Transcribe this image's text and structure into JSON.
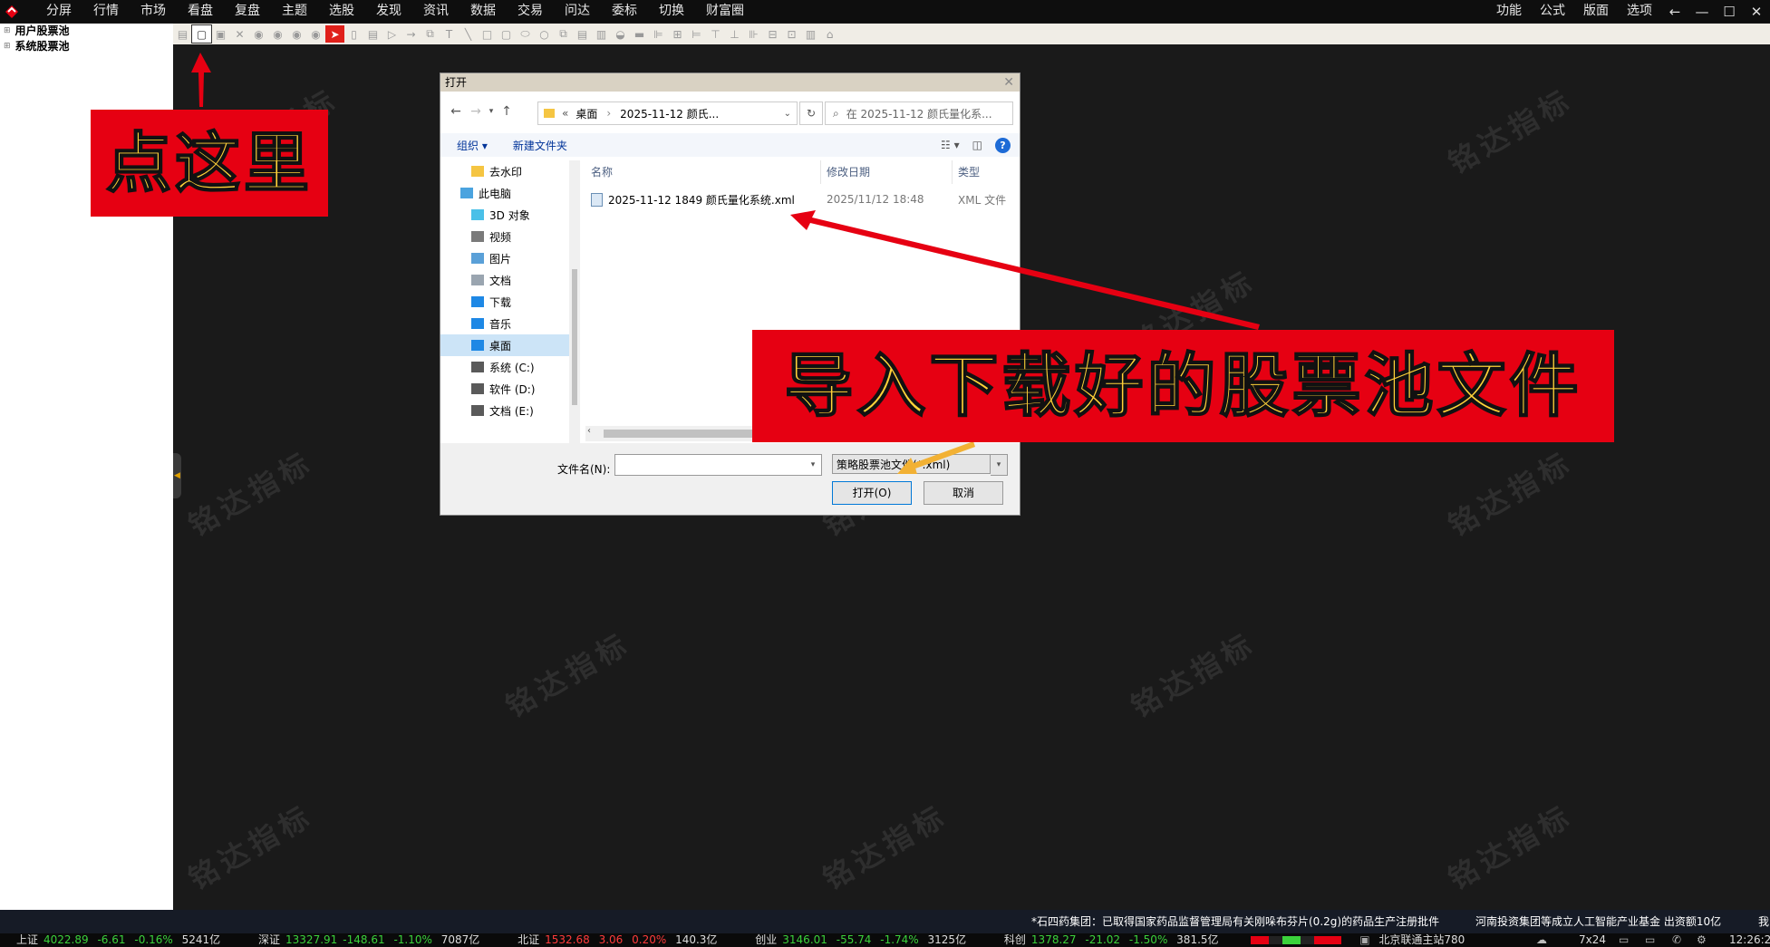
{
  "menu": {
    "left": [
      "分屏",
      "行情",
      "市场",
      "看盘",
      "复盘",
      "主题",
      "选股",
      "发现",
      "资讯",
      "数据",
      "交易",
      "问达",
      "委标",
      "切换",
      "财富圈"
    ],
    "right": [
      "功能",
      "公式",
      "版面",
      "选项"
    ]
  },
  "sidebar": {
    "items": [
      {
        "label": "用户股票池"
      },
      {
        "label": "系统股票池"
      }
    ]
  },
  "watermark": "铭达指标",
  "callouts": {
    "click_here": "点这里",
    "import": "导入下载好的股票池文件"
  },
  "dialog": {
    "title": "打开",
    "address": {
      "prefix": "«",
      "crumb1": "桌面",
      "crumb2": "2025-11-12 颜氏..."
    },
    "search_placeholder": "在 2025-11-12 颜氏量化系...",
    "commands": {
      "organize": "组织 ▾",
      "new_folder": "新建文件夹"
    },
    "nav": [
      {
        "label": "去水印",
        "icon": "folder-icon",
        "color": "#f5c542"
      },
      {
        "label": "此电脑",
        "icon": "computer-icon",
        "color": "#4aa3df"
      },
      {
        "label": "3D 对象",
        "icon": "cube-icon",
        "color": "#4ac0e8"
      },
      {
        "label": "视频",
        "icon": "video-icon",
        "color": "#7a7a7a"
      },
      {
        "label": "图片",
        "icon": "picture-icon",
        "color": "#5aa0d8"
      },
      {
        "label": "文档",
        "icon": "document-icon",
        "color": "#9aa5b0"
      },
      {
        "label": "下载",
        "icon": "download-icon",
        "color": "#1e88e5"
      },
      {
        "label": "音乐",
        "icon": "music-icon",
        "color": "#1e88e5"
      },
      {
        "label": "桌面",
        "icon": "desktop-icon",
        "color": "#1e88e5"
      },
      {
        "label": "系统 (C:)",
        "icon": "drive-icon",
        "color": "#5a5a5a"
      },
      {
        "label": "软件 (D:)",
        "icon": "drive-icon",
        "color": "#5a5a5a"
      },
      {
        "label": "文档 (E:)",
        "icon": "drive-icon",
        "color": "#5a5a5a"
      }
    ],
    "columns": {
      "name": "名称",
      "date": "修改日期",
      "type": "类型"
    },
    "file": {
      "name": "2025-11-12 1849 颜氏量化系统.xml",
      "date": "2025/11/12 18:48",
      "type": "XML 文件"
    },
    "filename_label": "文件名(N):",
    "filename_value": "",
    "filter": "策略股票池文件(*.xml)",
    "open_button": "打开(O)",
    "cancel_button": "取消"
  },
  "news": {
    "item1": "*石四药集团：已取得国家药品监督管理局有关刚哚布芬片(0.2g)的药品生产注册批件",
    "item2": "河南投资集团等成立人工智能产业基金 出资额10亿",
    "item3": "我"
  },
  "status": {
    "sh": {
      "label": "上证",
      "value": "4022.89",
      "change": "-6.61",
      "pct": "-0.16%",
      "amount": "5241亿"
    },
    "sz": {
      "label": "深证",
      "value": "13327.91",
      "change": "-148.61",
      "pct": "-1.10%",
      "amount": "7087亿"
    },
    "bj": {
      "label": "北证",
      "value": "1532.68",
      "change": "3.06",
      "pct": "0.20%",
      "amount": "140.3亿"
    },
    "cy": {
      "label": "创业",
      "value": "3146.01",
      "change": "-55.74",
      "pct": "-1.74%",
      "amount": "3125亿"
    },
    "kc": {
      "label": "科创",
      "value": "1378.27",
      "change": "-21.02",
      "pct": "-1.50%",
      "amount": "381.5亿"
    },
    "server": "北京联通主站780",
    "mode": "7x24",
    "time": "12:26:2"
  },
  "colors": {
    "accent_red": "#e60012",
    "callout_text": "#ffd23a",
    "up": "#ff3b3b",
    "down": "#3bd23b"
  }
}
